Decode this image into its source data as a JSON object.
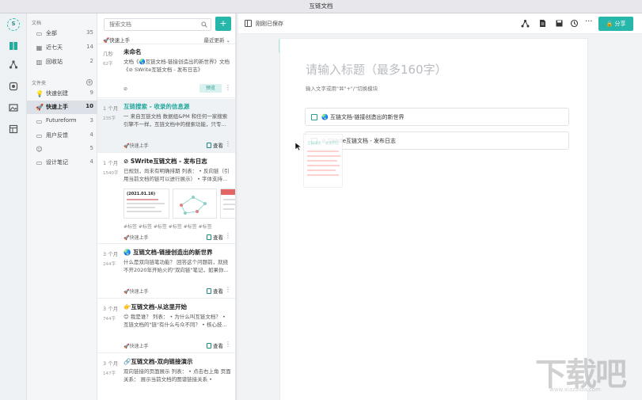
{
  "window": {
    "title": "互链文档"
  },
  "rail": {
    "logo_letter": "S"
  },
  "sidebar": {
    "docs_label": "文档",
    "docs_items": [
      {
        "icon": "folder-icon",
        "label": "全部",
        "count": "35"
      },
      {
        "icon": "calendar-icon",
        "label": "近七天",
        "count": "14"
      },
      {
        "icon": "trash-icon",
        "label": "回收站",
        "count": "2"
      }
    ],
    "folders_label": "文件夹",
    "folder_items": [
      {
        "icon": "bulb-icon",
        "label": "快速创建",
        "count": "9"
      },
      {
        "icon": "rocket-icon",
        "label": "快速上手",
        "count": "10"
      },
      {
        "icon": "folder-icon",
        "label": "Futureform",
        "count": "3"
      },
      {
        "icon": "folder-icon",
        "label": "用户反馈",
        "count": "4"
      },
      {
        "icon": "smile-icon",
        "label": "",
        "count": "5"
      },
      {
        "icon": "folder-icon",
        "label": "设计笔记",
        "count": "4"
      }
    ]
  },
  "doclist": {
    "search_placeholder": "搜索文档",
    "add_label": "+",
    "folder_name": "🚀快速上手",
    "sort_label": "最近更新",
    "cards": [
      {
        "time": "几秒",
        "words": "62字",
        "title": "未命名",
        "snippet": "文档《🌏互链文档-链接创造出的新世界》文档《⊘ SWrite互链文档 - 发布日志》",
        "tag": "⊘",
        "action": "预览"
      },
      {
        "time": "1 个月",
        "words": "235字",
        "title": "互链搜索 - 收录的信息源",
        "snippet": "一 来自互链文档 数据组&PM 和任何一家搜索引擎不一样，互链文档中的搜索功能，只专...",
        "tag": "🚀快速上手",
        "action": "查看"
      },
      {
        "time": "1 个月",
        "words": "1540字",
        "title": "⊘ SWrite互链文档 - 发布日志",
        "snippet": "已规划，尚未有明确排期 列表： • 反向链（引用当前文档的链可以进行展示） • 字体支持...",
        "tag": "🚀快速上手",
        "action": "查看",
        "hashtags": "#标签  #标签  #标签  #标签  #标签  #标签",
        "thumb_caption": "(2021.01.16)"
      },
      {
        "time": "3 个月",
        "words": "244字",
        "title": "🌏 互链文档-链接创造出的新世界",
        "snippet": "什么是双向链笔功能？ 回答这个问题前，就绕不开2020年开始火的\"双向链\"笔记，如果你...",
        "tag": "🚀快速上手",
        "action": "查看"
      },
      {
        "time": "3 个月",
        "words": "744字",
        "title": "👉互链文档-从这里开始",
        "snippet": "😊 我是谁？ 列表： • 为什么叫互链文档？ • 互链文档的\"链\"有什么与众不同？ • 核心技...",
        "tag": "🚀快速上手",
        "action": "查看"
      },
      {
        "time": "3 个月",
        "words": "147字",
        "title": "🔗互链文档-双向链接演示",
        "snippet": "双向链接的页面展示 列表： • 点击右上角 页面关系： 展示当前文档的图谱链接关系 •",
        "tag": "",
        "action": ""
      }
    ]
  },
  "editor": {
    "save_status": "刚刚已保存",
    "share_label": "分享",
    "title_placeholder": "请输入标题（最多160字）",
    "hint": "输入文字或用\"⌘\"+\"/\"切换模块",
    "link_cards": [
      "🌏 互链文档-链接创造出的新世界",
      "⊘ SWrite互链文档 - 发布日志"
    ],
    "ghost_title": "互链搜索 - 收录的信"
  },
  "watermark": {
    "main": "下载吧",
    "sub": "www.xiazaiba.com"
  },
  "colors": {
    "accent": "#26b6aa",
    "selected_bg": "#eef2f5",
    "rail_bg": "#eef1f4"
  }
}
